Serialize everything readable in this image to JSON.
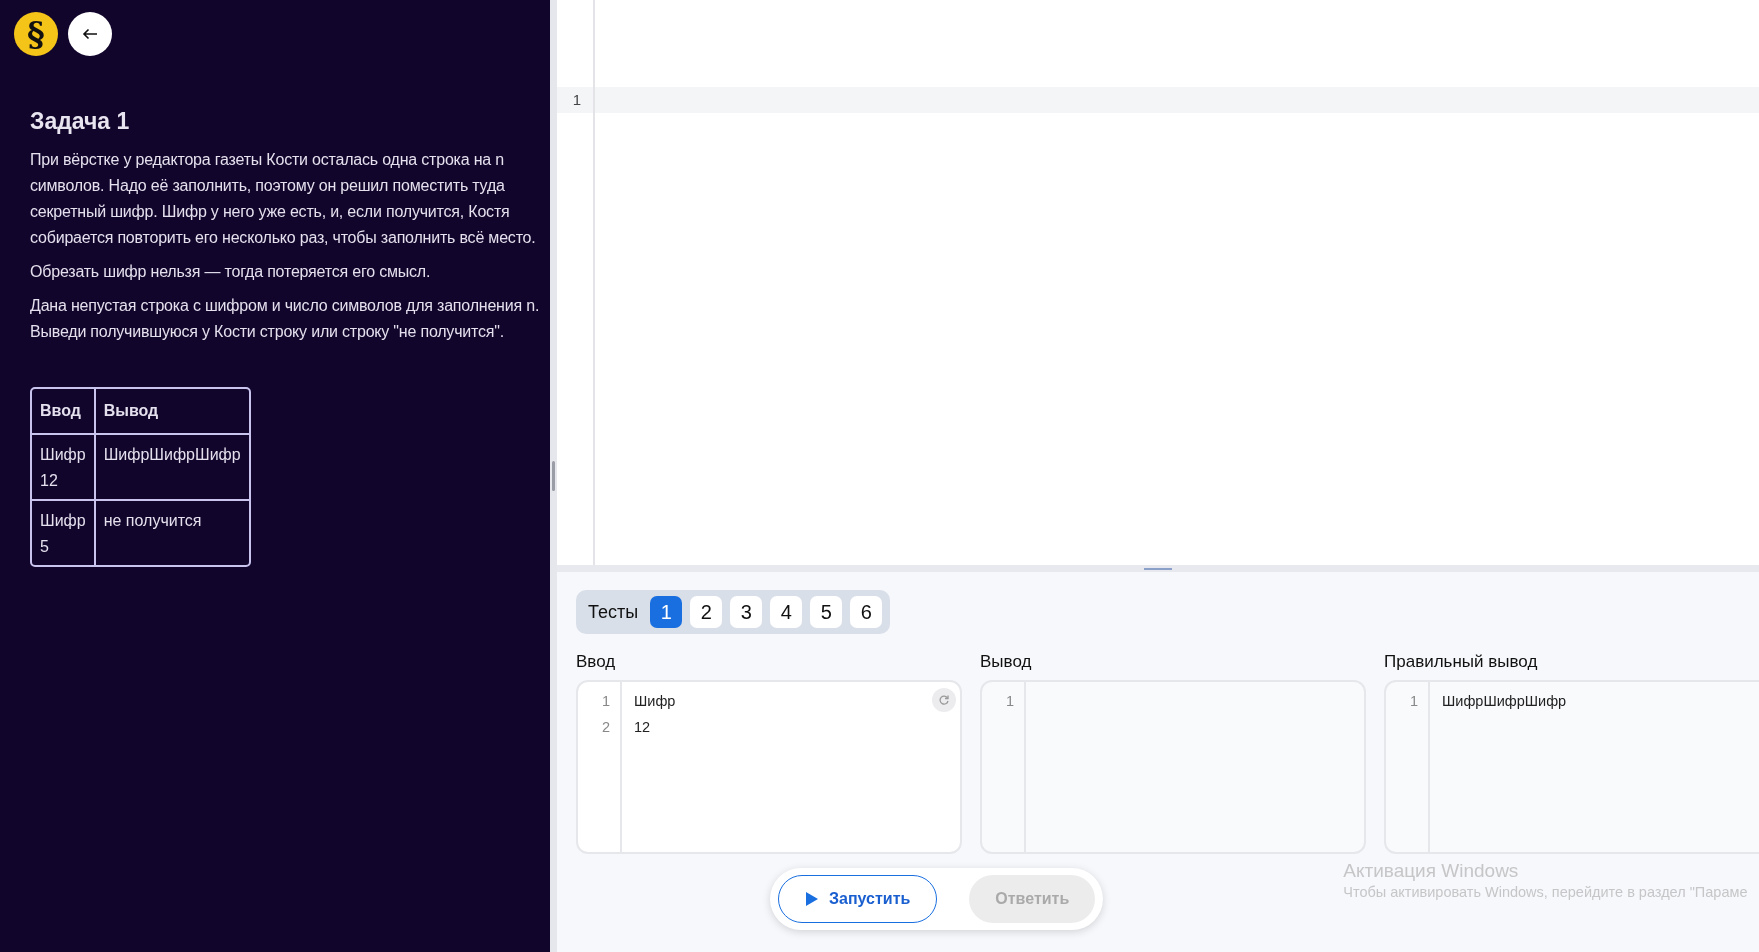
{
  "sidebar": {
    "logo": "§",
    "title": "Задача 1",
    "paragraphs": [
      "При вёрстке у редактора газеты Кости осталась одна строка на n символов. Надо её заполнить, поэтому он решил поместить туда секретный шифр. Шифр у него уже есть, и, если получится, Костя собирается повторить его несколько раз, чтобы заполнить всё место.",
      "Обрезать шифр нельзя — тогда потеряется его смысл.",
      "Дана непустая строка с шифром и число символов для заполнения n. Выведи получившуюся у Кости строку или строку \"не получится\"."
    ],
    "table": {
      "columns": [
        "Ввод",
        "Вывод"
      ],
      "rows": [
        [
          [
            "Шифр",
            "12"
          ],
          [
            "ШифрШифрШифр"
          ]
        ],
        [
          [
            "Шифр",
            "5"
          ],
          [
            "не получится"
          ]
        ]
      ]
    }
  },
  "editor": {
    "line_numbers": [
      "1"
    ]
  },
  "tests": {
    "label": "Тесты",
    "items": [
      {
        "label": "1",
        "selected": true
      },
      {
        "label": "2",
        "selected": false
      },
      {
        "label": "3",
        "selected": false
      },
      {
        "label": "4",
        "selected": false
      },
      {
        "label": "5",
        "selected": false
      },
      {
        "label": "6",
        "selected": false
      }
    ]
  },
  "panels": [
    {
      "kind": "editable",
      "title": "Ввод",
      "lines": [
        {
          "number": "1",
          "text": "Шифр"
        },
        {
          "number": "2",
          "text": "12"
        }
      ]
    },
    {
      "kind": "readonly",
      "title": "Вывод",
      "lines": [
        {
          "number": "1"
        }
      ]
    },
    {
      "kind": "readonly",
      "title": "Правильный вывод",
      "lines": [
        {
          "number": "1",
          "text": "ШифрШифрШифр"
        }
      ]
    }
  ],
  "actions": [
    {
      "kind": "run",
      "label": "Запустить",
      "disabled": false
    },
    {
      "kind": "answer",
      "label": "Ответить",
      "disabled": true
    }
  ],
  "os_notice": {
    "title": "Активация Windows",
    "text": "Чтобы активировать Windows, перейдите в раздел \"Параме"
  }
}
